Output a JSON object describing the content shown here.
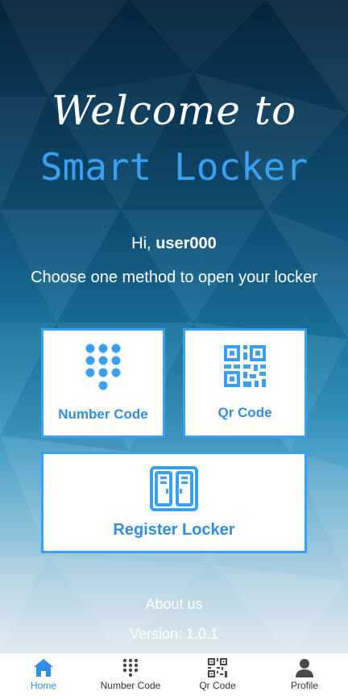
{
  "header": {
    "welcome": "Welcome to",
    "title": "Smart Locker"
  },
  "greeting": {
    "prefix": "Hi,",
    "username": "user000",
    "instruction": "Choose one method to open your locker"
  },
  "actions": {
    "number_code": "Number Code",
    "qr_code": "Qr Code",
    "register_locker": "Register Locker"
  },
  "footer": {
    "about": "About us",
    "version": "Version: 1.0.1"
  },
  "nav": {
    "home": "Home",
    "number_code": "Number Code",
    "qr_code": "Qr Code",
    "profile": "Profile"
  },
  "colors": {
    "accent": "#3aa0f2",
    "accent_dark": "#2f8ee6",
    "nav_inactive": "#333333"
  },
  "icons": {
    "number_code": "keypad-icon",
    "qr_code": "qr-code-icon",
    "register_locker": "locker-icon",
    "home": "home-icon",
    "profile": "person-icon"
  }
}
